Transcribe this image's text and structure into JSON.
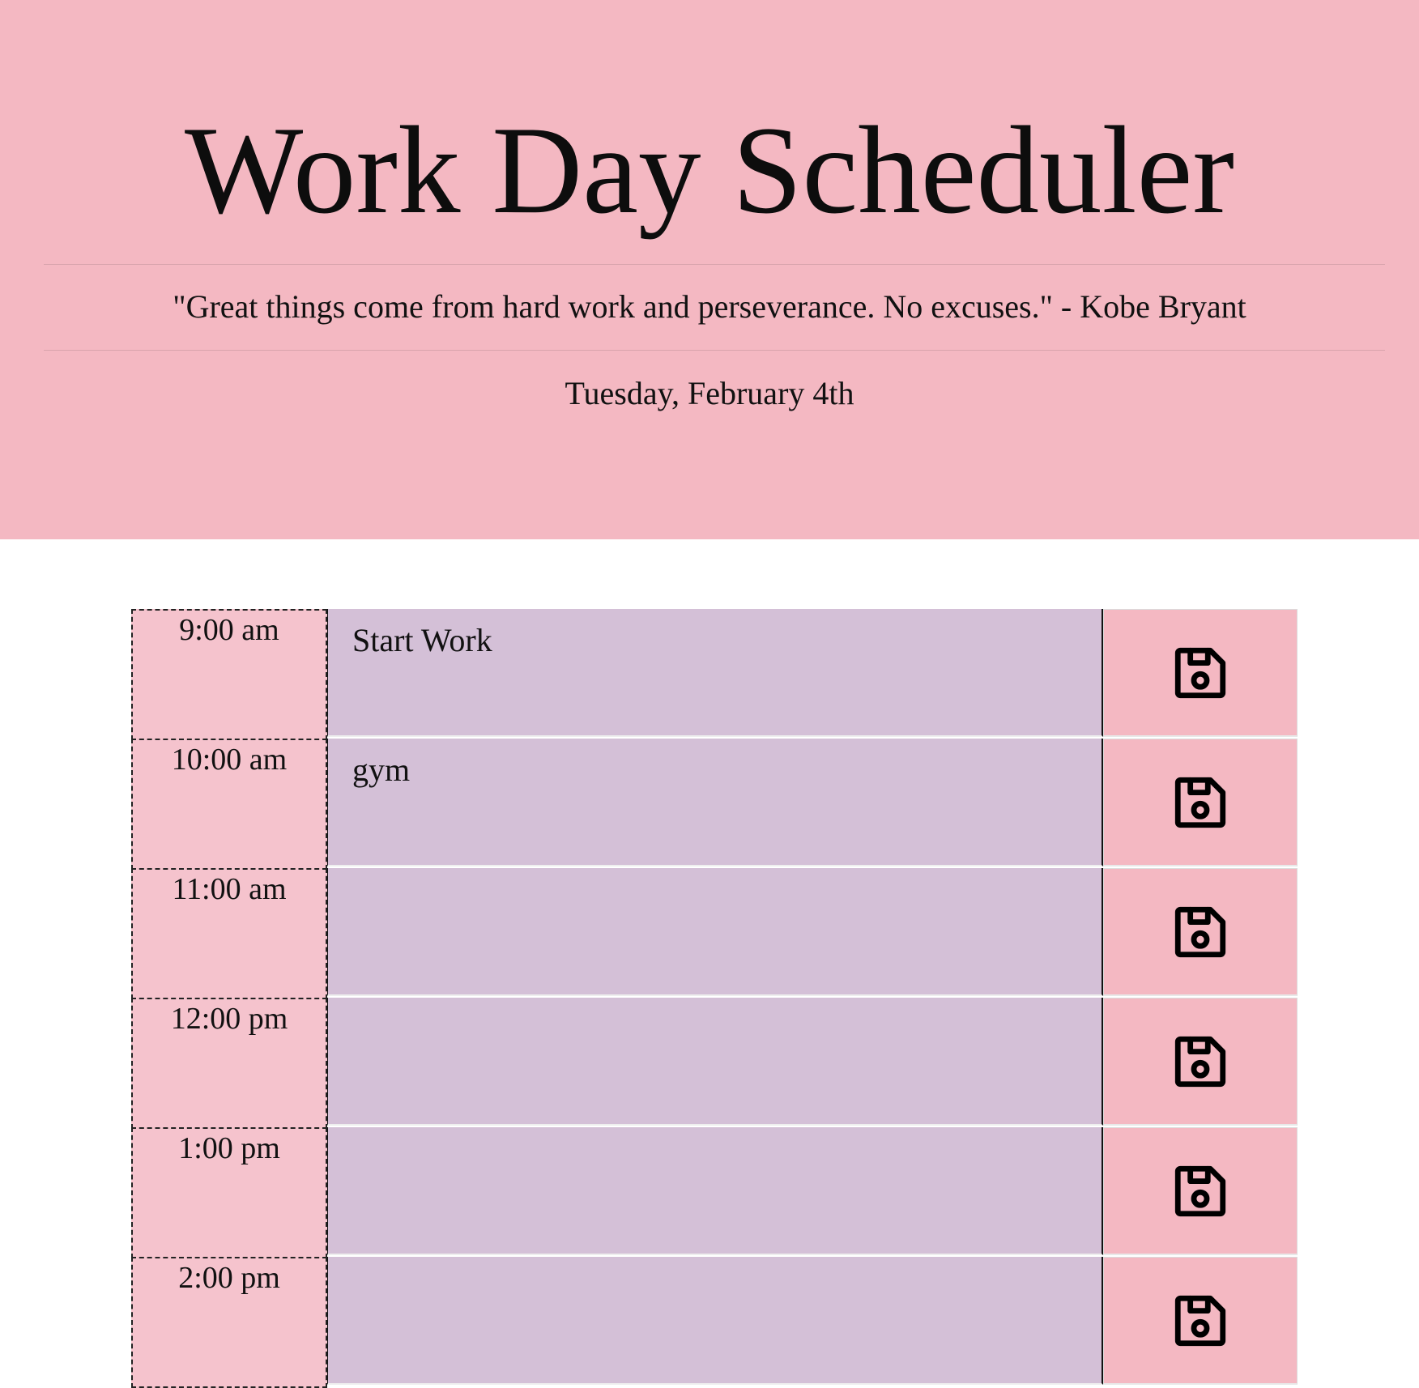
{
  "header": {
    "title": "Work Day Scheduler",
    "quote": "\"Great things come from hard work and perseverance. No excuses.\" - Kobe Bryant",
    "date": "Tuesday, February 4th"
  },
  "schedule": {
    "rows": [
      {
        "hour": "9:00 am",
        "text": "Start Work"
      },
      {
        "hour": "10:00 am",
        "text": "gym"
      },
      {
        "hour": "11:00 am",
        "text": ""
      },
      {
        "hour": "12:00 pm",
        "text": ""
      },
      {
        "hour": "1:00 pm",
        "text": ""
      },
      {
        "hour": "2:00 pm",
        "text": ""
      }
    ],
    "save_icon": "floppy-disk-icon"
  },
  "colors": {
    "header_bg": "#f4b8c2",
    "hour_bg": "#f5c3cd",
    "textarea_bg": "#d4c0d7",
    "save_bg": "#f4b8c2"
  }
}
